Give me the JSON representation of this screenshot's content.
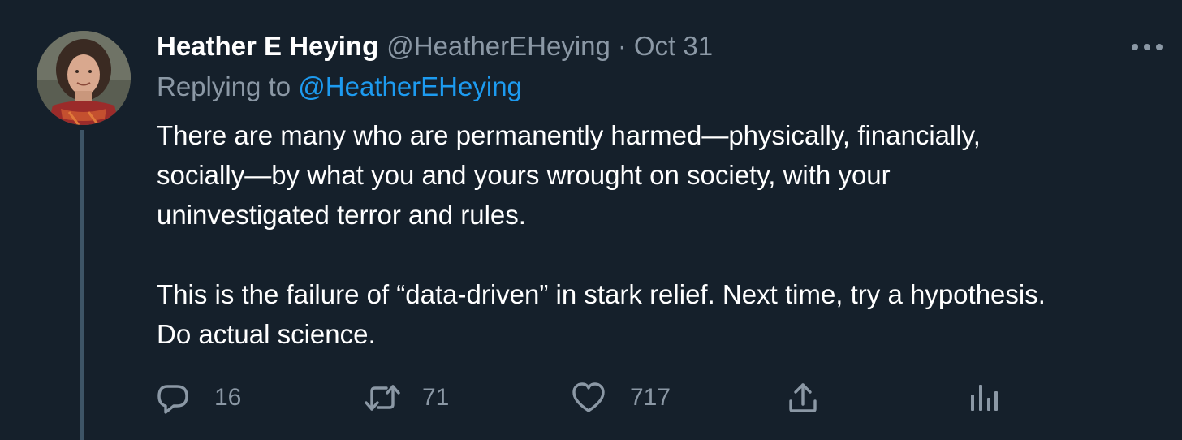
{
  "tweet": {
    "author_name": "Heather E Heying",
    "author_handle": "@HeatherEHeying",
    "separator": "·",
    "timestamp": "Oct 31",
    "replying_prefix": "Replying to ",
    "replying_handle": "@HeatherEHeying",
    "paragraph1": [
      "There are many who are permanently harmed—physically, financially,",
      "socially—by what you and yours wrought on society, with your",
      "uninvestigated terror and rules."
    ],
    "paragraph2": [
      "This is the failure of “data-driven” in stark relief. Next time, try a hypothesis.",
      "Do actual science."
    ]
  },
  "actions": {
    "reply_count": "16",
    "retweet_count": "71",
    "like_count": "717"
  },
  "icons": {
    "more": "more-options-icon",
    "reply": "reply-icon",
    "retweet": "retweet-icon",
    "like": "heart-icon",
    "share": "share-icon",
    "analytics": "analytics-icon"
  },
  "colors": {
    "background": "#15202b",
    "text": "#ffffff",
    "secondary": "#8b98a5",
    "link": "#1d9bf0",
    "thread_line": "#3d5466"
  }
}
